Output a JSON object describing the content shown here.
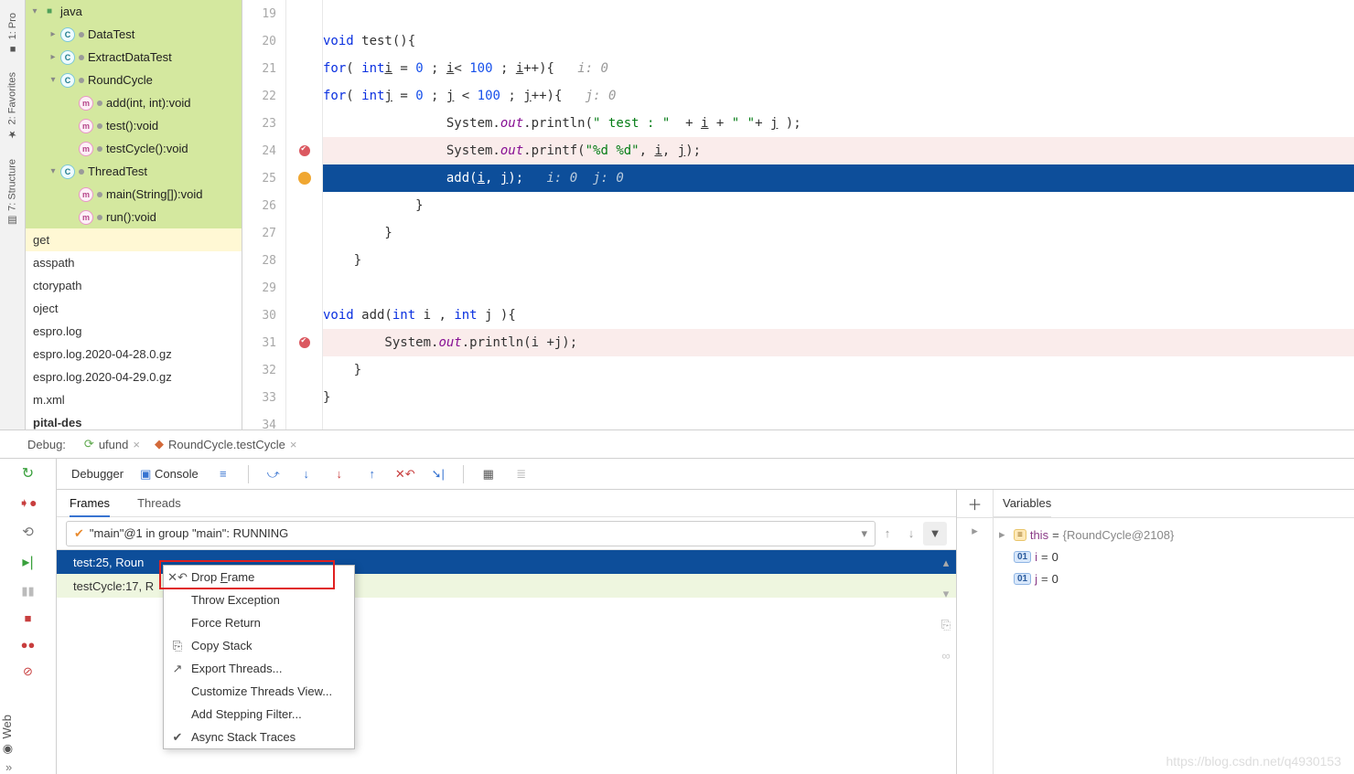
{
  "verticalTabs": [
    "1: Pro",
    "2: Favorites",
    "7: Structure"
  ],
  "projectTree": {
    "items": [
      {
        "type": "pkg",
        "indent": 0,
        "arrow": "▾",
        "label": "java",
        "selected": true
      },
      {
        "type": "class",
        "indent": 1,
        "arrow": "▸",
        "label": "DataTest",
        "selected": true,
        "dot": true
      },
      {
        "type": "class",
        "indent": 1,
        "arrow": "▸",
        "label": "ExtractDataTest",
        "selected": true,
        "dot": true
      },
      {
        "type": "class",
        "indent": 1,
        "arrow": "▾",
        "label": "RoundCycle",
        "selected": true,
        "dot": true
      },
      {
        "type": "method",
        "indent": 2,
        "label": "add(int, int):void",
        "selected": true,
        "dot": true
      },
      {
        "type": "method",
        "indent": 2,
        "label": "test():void",
        "selected": true,
        "dot": true
      },
      {
        "type": "method",
        "indent": 2,
        "label": "testCycle():void",
        "selected": true,
        "dot": true
      },
      {
        "type": "class",
        "indent": 1,
        "arrow": "▾",
        "label": "ThreadTest",
        "selected": true,
        "dot": true
      },
      {
        "type": "method",
        "indent": 2,
        "label": "main(String[]):void",
        "selected": true,
        "dot": true
      },
      {
        "type": "method",
        "indent": 2,
        "label": "run():void",
        "selected": true,
        "dot": true
      }
    ],
    "plain": [
      "get",
      "asspath",
      "ctorypath",
      "oject",
      "espro.log",
      "espro.log.2020-04-28.0.gz",
      "espro.log.2020-04-29.0.gz",
      "m.xml",
      "pital-des"
    ]
  },
  "editor": {
    "startLine": 19,
    "lines": [
      {
        "n": 19,
        "html": ""
      },
      {
        "n": 20,
        "html": "    <span class='kw'>void</span> test(){"
      },
      {
        "n": 21,
        "html": "        <span class='kw'>for</span>( <span class='kw'>int</span> <span class='underline'>i</span> = <span class='num'>0</span> ; <span class='underline'>i</span>&lt; <span class='num'>100</span> ; <span class='underline'>i</span>++){   <span class='hint'>i: 0</span>"
      },
      {
        "n": 22,
        "html": "            <span class='kw'>for</span>( <span class='kw'>int</span> <span class='underline'>j</span> = <span class='num'>0</span> ; <span class='underline'>j</span> &lt; <span class='num'>100</span> ; <span class='underline'>j</span>++){   <span class='hint'>j: 0</span>"
      },
      {
        "n": 23,
        "html": "                System.<span class='fld'>out</span>.println(<span class='str'>\" test : \"</span>  + <span class='underline'>i</span> + <span class='str'>\" \"</span>+ <span class='underline'>j</span> );"
      },
      {
        "n": 24,
        "html": "                System.<span class='fld'>out</span>.printf(<span class='str'>\"%d %d\"</span>, <span class='underline'>i</span>, <span class='underline'>j</span>);",
        "bp": true
      },
      {
        "n": 25,
        "html": "                add(<span class='underline'>i</span>, <span class='underline'>j</span>);   <span class='hint'>i: 0  j: 0</span>",
        "current": true,
        "bulb": true
      },
      {
        "n": 26,
        "html": "            }"
      },
      {
        "n": 27,
        "html": "        }"
      },
      {
        "n": 28,
        "html": "    }"
      },
      {
        "n": 29,
        "html": ""
      },
      {
        "n": 30,
        "html": "    <span class='kw'>void</span> add(<span class='kw'>int</span> i , <span class='kw'>int</span> j ){"
      },
      {
        "n": 31,
        "html": "        System.<span class='fld'>out</span>.println(i +j);",
        "bp": true
      },
      {
        "n": 32,
        "html": "    }"
      },
      {
        "n": 33,
        "html": "}"
      },
      {
        "n": 34,
        "html": ""
      }
    ]
  },
  "debugTabs": {
    "label": "Debug:",
    "tabs": [
      "ufund",
      "RoundCycle.testCycle"
    ]
  },
  "debugToolbar": {
    "tab1": "Debugger",
    "tab2": "Console"
  },
  "framesPanel": {
    "tabs": [
      "Frames",
      "Threads"
    ],
    "selector": "\"main\"@1 in group \"main\": RUNNING",
    "rows": [
      {
        "text": "test:25, Roun",
        "current": true
      },
      {
        "text": "testCycle:17, R",
        "current": false
      }
    ]
  },
  "contextMenu": {
    "items": [
      {
        "label": "Drop Frame",
        "icon": "drop",
        "highlighted": true
      },
      {
        "label": "Throw Exception"
      },
      {
        "label": "Force Return"
      },
      {
        "label": "Copy Stack",
        "icon": "copy"
      },
      {
        "label": "Export Threads...",
        "icon": "export"
      },
      {
        "label": "Customize Threads View..."
      },
      {
        "label": "Add Stepping Filter..."
      },
      {
        "label": "Async Stack Traces",
        "icon": "check"
      }
    ]
  },
  "variables": {
    "title": "Variables",
    "rows": [
      {
        "badge": "≡",
        "badgeType": "yellow",
        "name": "this",
        "val": "{RoundCycle@2108}",
        "kind": "obj",
        "arrow": "▸"
      },
      {
        "badge": "01",
        "badgeType": "blue",
        "name": "i",
        "val": "0",
        "kind": "prim"
      },
      {
        "badge": "01",
        "badgeType": "blue",
        "name": "j",
        "val": "0",
        "kind": "prim"
      }
    ]
  },
  "bottomTab": "Web",
  "watermark": "https://blog.csdn.net/q4930153"
}
